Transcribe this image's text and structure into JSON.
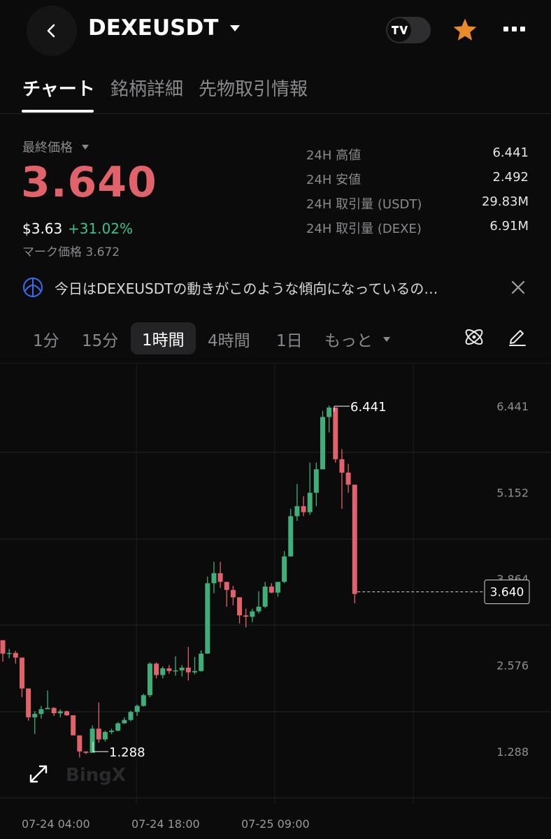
{
  "header": {
    "symbol": "DEXEUSDT",
    "icons": {
      "back": "back-arrow-icon",
      "dropdown": "triangle-down-icon",
      "tv": "tradingview-toggle-icon",
      "favorite": "star-icon",
      "more": "more-dots-icon"
    },
    "favorite_color": "#ea8a2c"
  },
  "tabs": [
    "チャート",
    "銘柄詳細",
    "先物取引情報"
  ],
  "price": {
    "label": "最終価格",
    "last": "3.640",
    "usd": "$3.63",
    "change": "+31.02%",
    "mark_label": "マーク価格",
    "mark": "3.672",
    "last_color": "#e0636b",
    "change_color": "#38c28b"
  },
  "stats": [
    {
      "label": "24H 高値",
      "value": "6.441"
    },
    {
      "label": "24H 安値",
      "value": "2.492"
    },
    {
      "label": "24H 取引量 (USDT)",
      "value": "29.83M"
    },
    {
      "label": "24H 取引量 (DEXE)",
      "value": "6.91M"
    }
  ],
  "banner": {
    "text": "今日はDEXEUSDTの動きがこのような傾向になっているの…",
    "icons": {
      "ai": "ai-atom-icon",
      "close": "close-icon"
    }
  },
  "timeframes": {
    "items": [
      "1分",
      "15分",
      "1時間",
      "4時間",
      "1日",
      "もっと"
    ],
    "selected": "1時間",
    "icons": {
      "indicator": "atom-indicator-icon",
      "draw": "pencil-icon",
      "more_dropdown": "triangle-down-icon"
    }
  },
  "chart_data": {
    "type": "candlestick",
    "y_ticks": [
      "6.441",
      "5.152",
      "3.864",
      "2.576",
      "1.288"
    ],
    "ylim": [
      0.5,
      7.1
    ],
    "x_ticks": [
      "07-24 04:00",
      "07-24 18:00",
      "07-25 09:00"
    ],
    "high_marker": "6.441",
    "low_marker": "1.288",
    "last_price_tag": "3.640",
    "up_color": "#3fae78",
    "down_color": "#e0636b",
    "watermark": "BingX",
    "candles": [
      [
        2.95,
        2.95,
        2.63,
        2.75
      ],
      [
        2.75,
        2.82,
        2.68,
        2.76
      ],
      [
        2.76,
        2.79,
        2.6,
        2.69
      ],
      [
        2.69,
        2.69,
        2.1,
        2.23
      ],
      [
        2.23,
        2.23,
        1.75,
        1.8
      ],
      [
        1.8,
        1.89,
        1.55,
        1.85
      ],
      [
        1.85,
        1.97,
        1.78,
        1.92
      ],
      [
        1.92,
        2.2,
        1.92,
        1.94
      ],
      [
        1.94,
        1.95,
        1.82,
        1.86
      ],
      [
        1.86,
        1.92,
        1.8,
        1.89
      ],
      [
        1.89,
        1.9,
        1.82,
        1.83
      ],
      [
        1.83,
        1.83,
        1.55,
        1.53
      ],
      [
        1.53,
        1.53,
        1.2,
        1.29
      ],
      [
        1.29,
        1.29,
        1.25,
        1.27
      ],
      [
        1.27,
        1.68,
        1.27,
        1.63
      ],
      [
        1.63,
        2.02,
        1.42,
        1.47
      ],
      [
        1.47,
        1.6,
        1.44,
        1.58
      ],
      [
        1.58,
        1.63,
        1.55,
        1.6
      ],
      [
        1.6,
        1.73,
        1.59,
        1.71
      ],
      [
        1.71,
        1.8,
        1.7,
        1.76
      ],
      [
        1.76,
        1.9,
        1.74,
        1.88
      ],
      [
        1.88,
        1.99,
        1.82,
        1.97
      ],
      [
        1.97,
        2.15,
        1.96,
        2.13
      ],
      [
        2.13,
        2.62,
        2.1,
        2.6
      ],
      [
        2.6,
        2.62,
        2.38,
        2.43
      ],
      [
        2.43,
        2.56,
        2.38,
        2.53
      ],
      [
        2.53,
        2.58,
        2.45,
        2.49
      ],
      [
        2.49,
        2.71,
        2.42,
        2.5
      ],
      [
        2.5,
        2.58,
        2.41,
        2.54
      ],
      [
        2.54,
        2.85,
        2.35,
        2.47
      ],
      [
        2.47,
        2.7,
        2.44,
        2.49
      ],
      [
        2.49,
        2.8,
        2.48,
        2.75
      ],
      [
        2.75,
        3.9,
        2.75,
        3.8
      ],
      [
        3.8,
        4.12,
        3.65,
        3.95
      ],
      [
        3.95,
        4.12,
        3.73,
        3.82
      ],
      [
        3.82,
        3.82,
        3.45,
        3.7
      ],
      [
        3.7,
        3.76,
        3.47,
        3.59
      ],
      [
        3.59,
        3.59,
        3.2,
        3.32
      ],
      [
        3.32,
        3.42,
        3.14,
        3.3
      ],
      [
        3.3,
        3.42,
        3.22,
        3.38
      ],
      [
        3.38,
        3.68,
        3.35,
        3.45
      ],
      [
        3.45,
        3.82,
        3.43,
        3.75
      ],
      [
        3.75,
        3.8,
        3.65,
        3.66
      ],
      [
        3.66,
        3.81,
        3.6,
        3.82
      ],
      [
        3.82,
        4.28,
        3.8,
        4.2
      ],
      [
        4.2,
        4.91,
        4.2,
        4.8
      ],
      [
        4.8,
        5.28,
        4.73,
        4.95
      ],
      [
        4.95,
        5.1,
        4.8,
        4.86
      ],
      [
        4.86,
        5.6,
        4.82,
        5.15
      ],
      [
        5.15,
        5.6,
        4.95,
        5.5
      ],
      [
        5.5,
        6.37,
        5.5,
        6.28
      ],
      [
        6.28,
        6.45,
        6.05,
        6.42
      ],
      [
        6.42,
        6.42,
        5.6,
        5.65
      ],
      [
        5.65,
        5.8,
        4.91,
        5.45
      ],
      [
        5.45,
        5.58,
        5.15,
        5.27
      ],
      [
        5.27,
        5.27,
        3.5,
        3.64
      ]
    ]
  }
}
